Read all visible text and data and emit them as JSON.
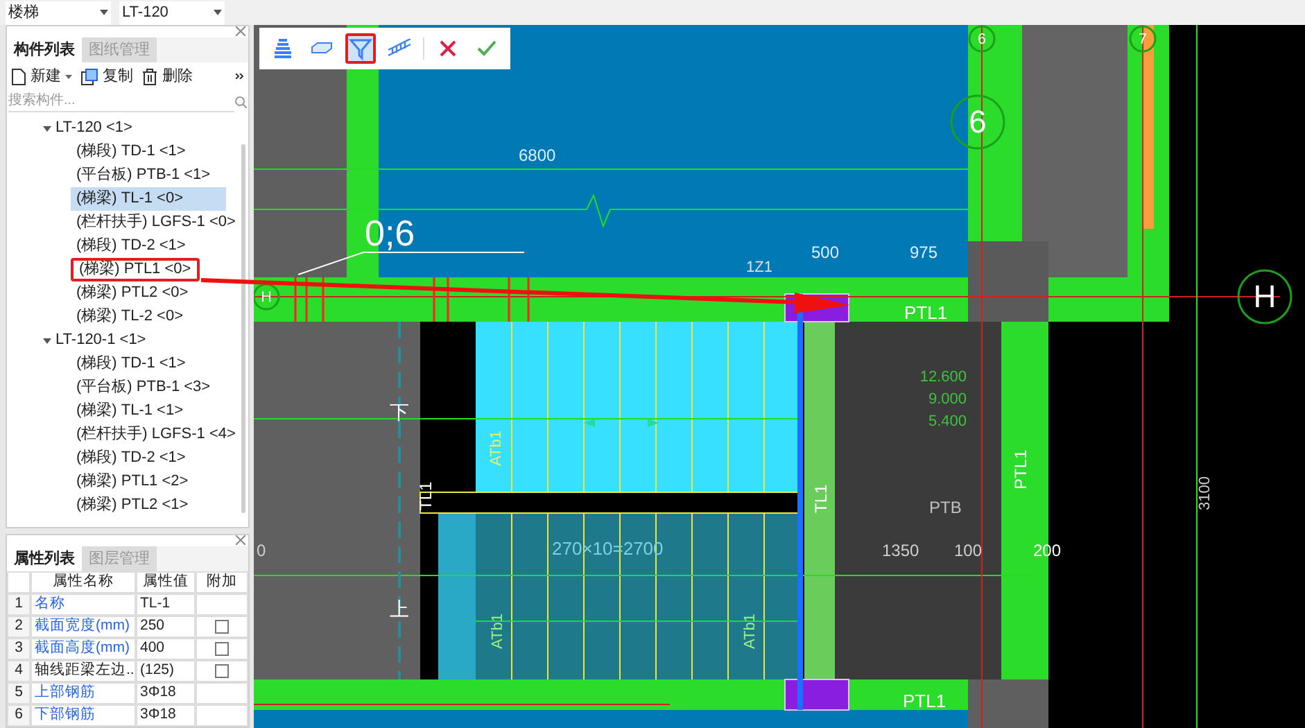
{
  "top_bar": {
    "selectors": [
      {
        "value": "楼梯"
      },
      {
        "value": "LT-120"
      }
    ]
  },
  "component_panel": {
    "tabs": [
      {
        "label": "构件列表",
        "selected": true
      },
      {
        "label": "图纸管理",
        "selected": false
      }
    ],
    "toolbar": [
      {
        "kind": "new",
        "label": "新建",
        "dropdown": true
      },
      {
        "kind": "copy",
        "label": "复制",
        "dropdown": false
      },
      {
        "kind": "delete",
        "label": "删除",
        "dropdown": false
      }
    ],
    "search": {
      "placeholder": "搜索构件..."
    },
    "tree": [
      {
        "label": "LT-120 <1>",
        "expanded": true,
        "children": [
          {
            "label": "(梯段) TD-1 <1>",
            "selected": false,
            "annotated": false
          },
          {
            "label": "(平台板) PTB-1 <1>",
            "selected": false,
            "annotated": false
          },
          {
            "label": "(梯梁) TL-1 <0>",
            "selected": true,
            "annotated": false
          },
          {
            "label": "(栏杆扶手) LGFS-1 <0>",
            "selected": false,
            "annotated": false
          },
          {
            "label": "(梯段) TD-2 <1>",
            "selected": false,
            "annotated": false
          },
          {
            "label": "(梯梁) PTL1 <0>",
            "selected": false,
            "annotated": true
          },
          {
            "label": "(梯梁) PTL2 <0>",
            "selected": false,
            "annotated": false
          },
          {
            "label": "(梯梁) TL-2 <0>",
            "selected": false,
            "annotated": false
          }
        ]
      },
      {
        "label": "LT-120-1 <1>",
        "expanded": true,
        "children": [
          {
            "label": "(梯段) TD-1 <1>",
            "selected": false,
            "annotated": false
          },
          {
            "label": "(平台板) PTB-1 <3>",
            "selected": false,
            "annotated": false
          },
          {
            "label": "(梯梁) TL-1 <1>",
            "selected": false,
            "annotated": false
          },
          {
            "label": "(栏杆扶手) LGFS-1 <4>",
            "selected": false,
            "annotated": false
          },
          {
            "label": "(梯段) TD-2 <1>",
            "selected": false,
            "annotated": false
          },
          {
            "label": "(梯梁) PTL1 <2>",
            "selected": false,
            "annotated": false
          },
          {
            "label": "(梯梁) PTL2 <1>",
            "selected": false,
            "annotated": false
          }
        ]
      }
    ]
  },
  "property_panel": {
    "tabs": [
      {
        "label": "属性列表",
        "selected": true
      },
      {
        "label": "图层管理",
        "selected": false
      }
    ],
    "columns": [
      "属性名称",
      "属性值",
      "附加"
    ],
    "rows": [
      {
        "index": "1",
        "name": "名称",
        "value": "TL-1",
        "public": true
      },
      {
        "index": "2",
        "name": "截面宽度(mm)",
        "value": "250",
        "public": true,
        "checked": false
      },
      {
        "index": "3",
        "name": "截面高度(mm)",
        "value": "400",
        "public": true,
        "checked": false
      },
      {
        "index": "4",
        "name": "轴线距梁左边...",
        "value": "(125)",
        "public": false,
        "checked": false
      },
      {
        "index": "5",
        "name": "上部钢筋",
        "value": "3Φ18",
        "public": true
      },
      {
        "index": "6",
        "name": "下部钢筋",
        "value": "3Φ18",
        "public": true
      }
    ]
  },
  "canvas_toolbar": [
    {
      "kind": "stair",
      "selected": false,
      "annotated": false
    },
    {
      "kind": "slab",
      "selected": false,
      "annotated": false
    },
    {
      "kind": "beam",
      "selected": true,
      "annotated": true
    },
    {
      "kind": "railing",
      "selected": false,
      "annotated": false
    },
    {
      "kind": "cancel",
      "selected": false,
      "annotated": false
    },
    {
      "kind": "confirm",
      "selected": false,
      "annotated": false
    }
  ],
  "canvas": {
    "axis_bubbles": [
      "6",
      "7",
      "6",
      "H",
      "H"
    ],
    "labels": [
      "6800",
      "0;6",
      "500",
      "975",
      "1Z1",
      "PTL1",
      "12.600",
      "9.000",
      "5.400",
      "下",
      "ATb1",
      "TL1",
      "PTL1",
      "TL1",
      "PTB",
      "3100",
      "0",
      "270×10=2700",
      "1350",
      "100",
      "200",
      "上",
      "ATb1",
      "ATb1",
      "PTL1"
    ]
  }
}
